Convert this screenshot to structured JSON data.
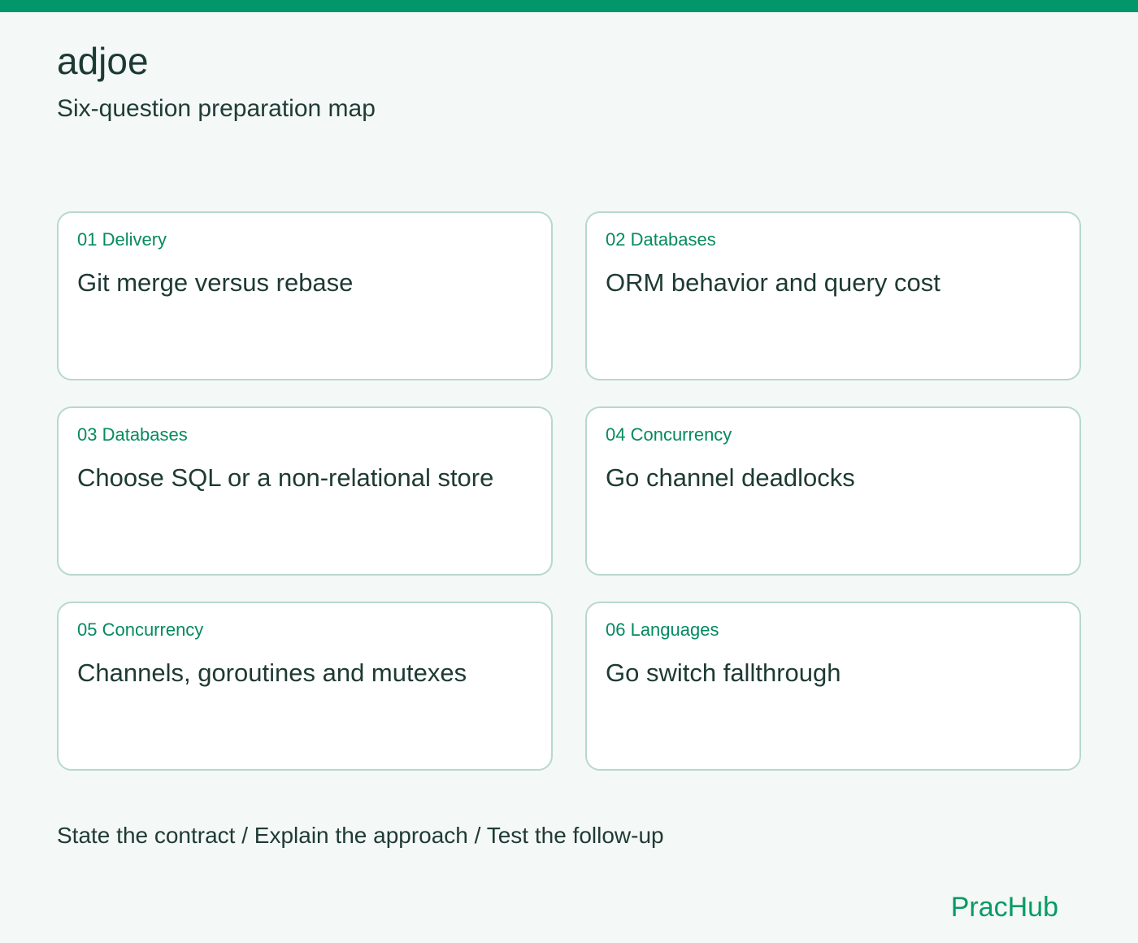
{
  "header": {
    "title": "adjoe",
    "subtitle": "Six-question preparation map"
  },
  "cards": [
    {
      "tag": "01 Delivery",
      "title": "Git merge versus rebase"
    },
    {
      "tag": "02 Databases",
      "title": "ORM behavior and query cost"
    },
    {
      "tag": "03 Databases",
      "title": "Choose SQL or a non-relational store"
    },
    {
      "tag": "04 Concurrency",
      "title": "Go channel deadlocks"
    },
    {
      "tag": "05 Concurrency",
      "title": "Channels, goroutines and mutexes"
    },
    {
      "tag": "06 Languages",
      "title": "Go switch fallthrough"
    }
  ],
  "footer": {
    "steps": "State the contract / Explain the approach / Test the follow-up",
    "brand": "PracHub"
  },
  "colors": {
    "accent": "#03966a",
    "background": "#f4f8f6",
    "card_border": "#b7d8cd",
    "tag_text": "#058a60",
    "body_text": "#1d3a33"
  }
}
